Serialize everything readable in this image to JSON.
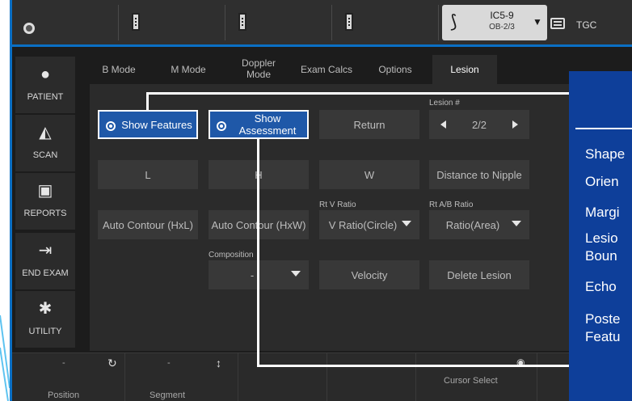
{
  "topbar": {
    "probe": {
      "name": "IC5-9",
      "preset": "OB-2/3"
    },
    "tgc_label": "TGC"
  },
  "nav": [
    {
      "label": "PATIENT",
      "icon": "patient-icon"
    },
    {
      "label": "SCAN",
      "icon": "scan-icon"
    },
    {
      "label": "REPORTS",
      "icon": "reports-icon"
    },
    {
      "label": "END EXAM",
      "icon": "end-exam-icon"
    },
    {
      "label": "UTILITY",
      "icon": "gear-icon"
    }
  ],
  "tabs": [
    "B Mode",
    "M Mode",
    "Doppler Mode",
    "Exam Calcs",
    "Options",
    "Lesion"
  ],
  "panel": {
    "show_features": "Show Features",
    "show_assessment": "Show Assessment",
    "return": "Return",
    "lesion_label": "Lesion #",
    "lesion_value": "2/2",
    "l": "L",
    "h": "H",
    "w": "W",
    "distance": "Distance to Nipple",
    "auto_contour_hxl": "Auto Contour (HxL)",
    "auto_contour_hxw": "Auto Contour (HxW)",
    "rtv_label": "Rt V Ratio",
    "rtv_value": "V Ratio(Circle)",
    "rtab_label": "Rt A/B Ratio",
    "rtab_value": "Ratio(Area)",
    "composition_label": "Composition",
    "composition_value": "-",
    "velocity": "Velocity",
    "delete_lesion": "Delete Lesion"
  },
  "bottom": {
    "position_value": "-",
    "position_label": "Position",
    "segment_value": "-",
    "segment_label": "Segment",
    "cursor_select": "Cursor Select"
  },
  "overlay": {
    "items": [
      "Shape",
      "Orien",
      "Margi",
      "Lesio",
      "Boun",
      "Echo",
      "Poste",
      "Featu"
    ]
  },
  "colors": {
    "accent": "#1f58a8",
    "overlay": "#0e3f9a",
    "topbar_border": "#0a6fc4"
  }
}
